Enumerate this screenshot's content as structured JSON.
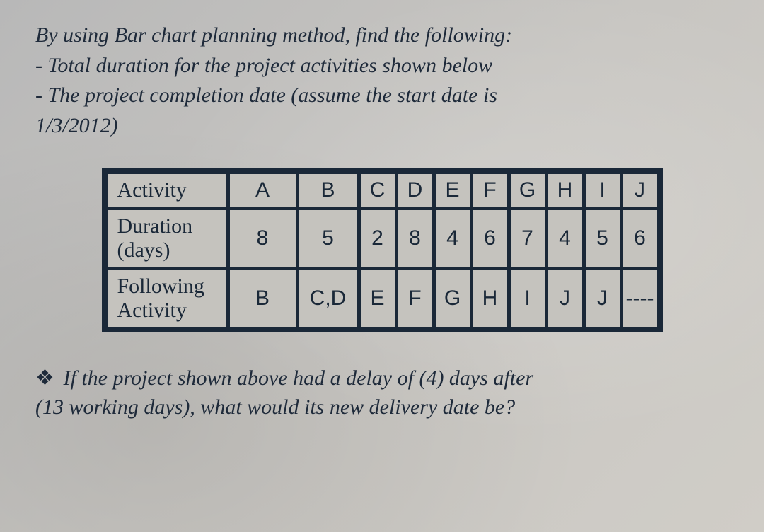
{
  "intro": {
    "line1": "By using Bar chart planning method, find the following:",
    "line2": "- Total duration for the project activities shown below",
    "line3": "- The project completion date (assume the start date is",
    "line4": "1/3/2012)"
  },
  "table": {
    "row1_label": "Activity",
    "row2_label": "Duration (days)",
    "row3_label": "Following Activity",
    "activities": [
      "A",
      "B",
      "C",
      "D",
      "E",
      "F",
      "G",
      "H",
      "I",
      "J"
    ],
    "durations": [
      "8",
      "5",
      "2",
      "8",
      "4",
      "6",
      "7",
      "4",
      "5",
      "6"
    ],
    "following": [
      "B",
      "C,D",
      "E",
      "F",
      "G",
      "H",
      "I",
      "J",
      "J",
      "----"
    ]
  },
  "footer": {
    "bullet": "❖",
    "line1": "If the project shown above had a delay of (4) days after",
    "line2": "(13 working days), what would its new delivery date be?"
  }
}
